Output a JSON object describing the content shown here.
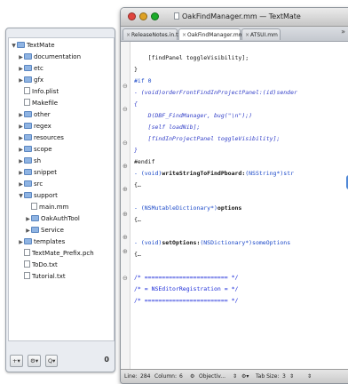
{
  "window": {
    "title": "OakFindManager.mm — TextMate",
    "file_icon": "document-icon",
    "traffic_lights": {
      "close": "#e0443e",
      "minimize": "#dea123",
      "zoom": "#1aab29"
    }
  },
  "tabs": [
    {
      "label": "ReleaseNotes.in.txt",
      "active": false
    },
    {
      "label": "OakFindManager.mm",
      "active": true
    },
    {
      "label": "ATSUI.mm",
      "active": false
    }
  ],
  "tabs_overflow": "»",
  "drawer": {
    "tree": [
      {
        "label": "TextMate",
        "kind": "folder",
        "expanded": true,
        "depth": 0
      },
      {
        "label": "documentation",
        "kind": "folder",
        "expanded": false,
        "depth": 1
      },
      {
        "label": "etc",
        "kind": "folder",
        "expanded": false,
        "depth": 1
      },
      {
        "label": "gfx",
        "kind": "folder",
        "expanded": false,
        "depth": 1
      },
      {
        "label": "Info.plist",
        "kind": "file",
        "depth": 1
      },
      {
        "label": "Makefile",
        "kind": "file",
        "depth": 1
      },
      {
        "label": "other",
        "kind": "folder",
        "expanded": false,
        "depth": 1
      },
      {
        "label": "regex",
        "kind": "folder",
        "expanded": false,
        "depth": 1
      },
      {
        "label": "resources",
        "kind": "folder",
        "expanded": false,
        "depth": 1
      },
      {
        "label": "scope",
        "kind": "folder",
        "expanded": false,
        "depth": 1
      },
      {
        "label": "sh",
        "kind": "folder",
        "expanded": false,
        "depth": 1
      },
      {
        "label": "snippet",
        "kind": "folder",
        "expanded": false,
        "depth": 1
      },
      {
        "label": "src",
        "kind": "folder",
        "expanded": false,
        "depth": 1
      },
      {
        "label": "support",
        "kind": "folder",
        "expanded": true,
        "depth": 1
      },
      {
        "label": "main.mm",
        "kind": "file",
        "depth": 2
      },
      {
        "label": "OakAuthTool",
        "kind": "folder",
        "expanded": false,
        "depth": 2
      },
      {
        "label": "Service",
        "kind": "folder",
        "expanded": false,
        "depth": 2
      },
      {
        "label": "templates",
        "kind": "folder",
        "expanded": false,
        "depth": 1
      },
      {
        "label": "TextMate_Prefix.pch",
        "kind": "file",
        "depth": 1
      },
      {
        "label": "ToDo.txt",
        "kind": "file",
        "depth": 1
      },
      {
        "label": "Tutorial.txt",
        "kind": "file",
        "depth": 1
      }
    ],
    "buttons": {
      "add": "+▾",
      "gear": "⚙▾",
      "search": "Q▾",
      "count": "0"
    }
  },
  "code_lines": [
    {
      "t": "    [findPanel toggleVisibility];",
      "c": ""
    },
    {
      "t": "}",
      "c": ""
    },
    {
      "t": "#if 0",
      "c": "kw"
    },
    {
      "t": "- (void)orderFrontFindInProjectPanel:(id)sender",
      "c": "ital"
    },
    {
      "t": "{",
      "c": "ital"
    },
    {
      "t": "    D(DBF_FindManager, bug(\"\\n\");)",
      "c": "ital"
    },
    {
      "t": "    [self loadNib];",
      "c": "ital"
    },
    {
      "t": "    [findInProjectPanel toggleVisibility];",
      "c": "ital"
    },
    {
      "t": "}",
      "c": "ital"
    },
    {
      "t": "#endif",
      "c": ""
    },
    {
      "t": "- (void)writeStringToFindPboard:(NSString*)str",
      "c": "mix1"
    },
    {
      "t": "{…",
      "c": ""
    },
    {
      "t": "",
      "c": ""
    },
    {
      "t": "- (NSMutableDictionary*)options",
      "c": "mix2"
    },
    {
      "t": "{…",
      "c": ""
    },
    {
      "t": "",
      "c": ""
    },
    {
      "t": "- (void)setOptions:(NSDictionary*)someOptions",
      "c": "mix3"
    },
    {
      "t": "{…",
      "c": ""
    },
    {
      "t": "",
      "c": ""
    },
    {
      "t": "/* ======================== */",
      "c": "cm"
    },
    {
      "t": "/* = NSEditorRegistration = */",
      "c": "cm"
    },
    {
      "t": "/* ======================== */",
      "c": "cm"
    }
  ],
  "status": {
    "line_label": "Line:",
    "line_value": "284",
    "column_label": "Column:",
    "column_value": "6",
    "grammar": "Objectiv...",
    "tab_label": "Tab Size:",
    "tab_value": "3"
  }
}
